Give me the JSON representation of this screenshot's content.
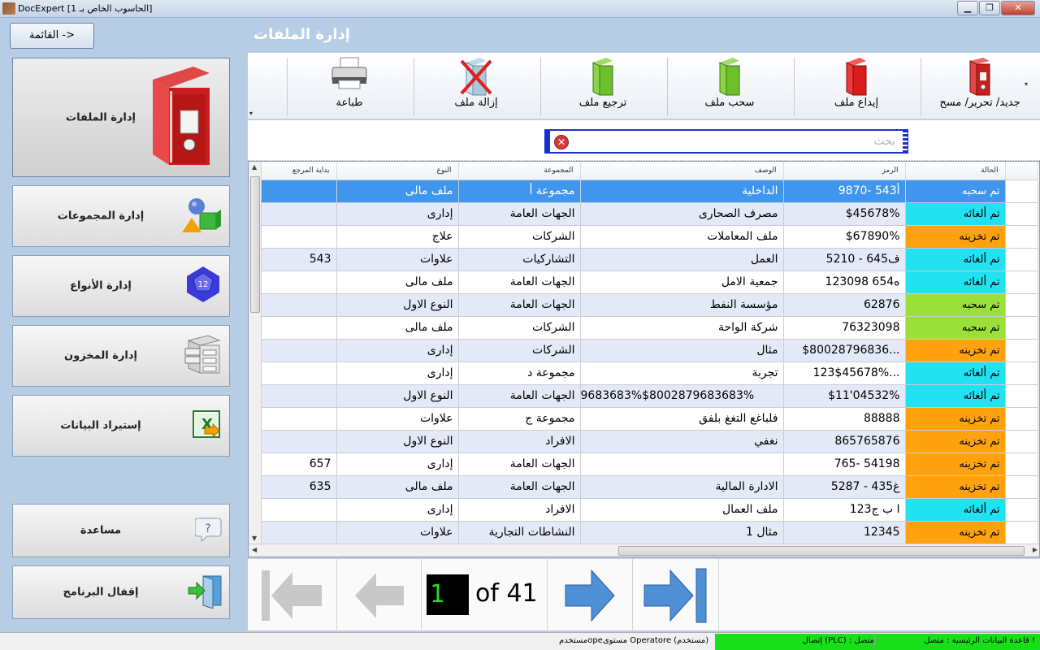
{
  "window": {
    "title": "DocExpert [الحاسوب الخاص بـ 1]",
    "minimize": "▁",
    "maximize": "❐",
    "close": "✕"
  },
  "sidebar": {
    "menu_button": "القائمة ->",
    "items": [
      {
        "label": "إدارة الملفات",
        "icon": "binder-icon"
      },
      {
        "label": "إدارة المجموعات",
        "icon": "shapes-icon"
      },
      {
        "label": "إدارة الأنواع",
        "icon": "dodecahedron-icon",
        "icon_text": "12"
      },
      {
        "label": "إدارة المخزون",
        "icon": "cabinet-icon"
      },
      {
        "label": "إستيراد البيانات",
        "icon": "import-icon"
      },
      {
        "label": "مساعدة",
        "icon": "help-icon",
        "icon_text": "?"
      },
      {
        "label": "إقفال البرنامج",
        "icon": "exit-door-icon"
      }
    ]
  },
  "header": {
    "title": "إدارة الملفات"
  },
  "toolbar": {
    "new_edit_delete": "جديد/ تحرير/ مسح",
    "deposit": "إيداع ملف",
    "withdraw": "سحب ملف",
    "return": "ترجيع ملف",
    "remove": "إزالة ملف",
    "print": "طباعة"
  },
  "search": {
    "placeholder": "بحث"
  },
  "table": {
    "columns": [
      "الحالة",
      "الرمز",
      "الوصف",
      "المجموعة",
      "النوع",
      "بداية المرجع"
    ],
    "rows": [
      {
        "status": "تم سحبه",
        "code": "9870- 543أ",
        "desc": "الداخلية",
        "group": "مجموعة أ",
        "type": "ملف مالى",
        "ref": ""
      },
      {
        "status": "تم ألغائه",
        "code": "$45678%",
        "desc": "مصرف الصحارى",
        "group": "الجهات العامة",
        "type": "إدارى",
        "ref": ""
      },
      {
        "status": "تم تخزينه",
        "code": "$67890%",
        "desc": "ملف المعاملات",
        "group": "الشركات",
        "type": "علاج",
        "ref": ""
      },
      {
        "status": "تم ألغائه",
        "code": "5210 - 645ف",
        "desc": "العمل",
        "group": "التشاركيات",
        "type": "علاوات",
        "ref": "543"
      },
      {
        "status": "تم ألغائه",
        "code": "123098 654ه",
        "desc": "جمعية الامل",
        "group": "الجهات العامة",
        "type": "ملف مالى",
        "ref": ""
      },
      {
        "status": "تم سحبه",
        "code": "62876",
        "desc": "مؤسسة النفط",
        "group": "الجهات العامة",
        "type": "النوع الاول",
        "ref": ""
      },
      {
        "status": "تم سحبه",
        "code": "76323098",
        "desc": "شركة الواحة",
        "group": "الشركات",
        "type": "ملف مالى",
        "ref": ""
      },
      {
        "status": "تم تخزينه",
        "code": "$80028796836...",
        "desc": "مثال",
        "group": "الشركات",
        "type": "إدارى",
        "ref": ""
      },
      {
        "status": "تم ألغائه",
        "code": "123$45678%...",
        "desc": "تجربة",
        "group": "مجموعة د",
        "type": "إدارى",
        "ref": ""
      },
      {
        "status": "تم ألغائه",
        "code": "$11'04532%",
        "desc": "9683683%$8002879683683%",
        "group": "الجهات العامة",
        "type": "النوع الاول",
        "ref": ""
      },
      {
        "status": "تم تخزينه",
        "code": "88888",
        "desc": "فلباغع التغغ بلفق",
        "group": "مجموعة ج",
        "type": "علاوات",
        "ref": ""
      },
      {
        "status": "تم تخزينه",
        "code": "865765876",
        "desc": "نغفي",
        "group": "الافراد",
        "type": "النوع الاول",
        "ref": ""
      },
      {
        "status": "تم تخزينه",
        "code": "765- 54198",
        "desc": "",
        "group": "الجهات العامة",
        "type": "إدارى",
        "ref": "657"
      },
      {
        "status": "تم تخزينه",
        "code": "5287 - 435غ",
        "desc": "الادارة المالية",
        "group": "الجهات العامة",
        "type": "ملف مالى",
        "ref": "635"
      },
      {
        "status": "تم ألغائه",
        "code": "123ا ب ج",
        "desc": "ملف العمال",
        "group": "الافراد",
        "type": "إدارى",
        "ref": ""
      },
      {
        "status": "تم تخزينه",
        "code": "12345",
        "desc": "مثال 1",
        "group": "النشاطات التجارية",
        "type": "علاوات",
        "ref": ""
      }
    ]
  },
  "status_colors": {
    "تم سحبه": "#9be03a",
    "تم ألغائه": "#22e1f0",
    "تم تخزينه": "#ffa20d"
  },
  "pager": {
    "current": "1",
    "of_text": "of 41"
  },
  "statusbar": {
    "db": "قاعدة البيانات الرئيسية : متصل !",
    "plc": "إتصال (PLC) : متصل",
    "user": "مستخدمopeمستوى Operatore (مستخدم)"
  }
}
